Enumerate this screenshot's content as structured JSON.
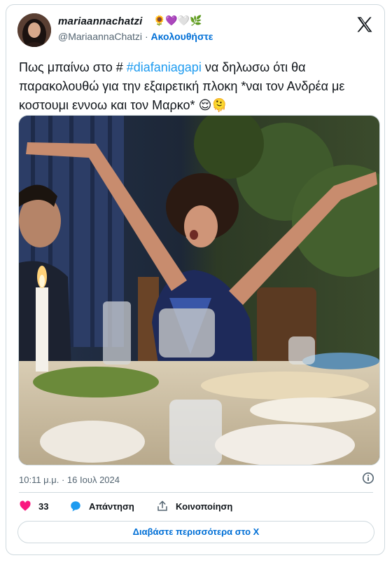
{
  "author": {
    "display_name": "mariaannachatzi",
    "name_emojis": "🌻💜🤍🌿",
    "handle": "@MariaannaChatzi",
    "separator": "·",
    "follow_label": "Ακολουθήστε"
  },
  "tweet": {
    "text_before": "Πως μπαίνω στο # ",
    "hashtag": "#diafaniagapi",
    "text_after": " να δηλωσω ότι θα παρακολουθώ για την εξαιρετική πλοκη *ναι τον Ανδρέα με κοστουμι εννοω και τον Μαρκο* ",
    "emojis": "😌🫠"
  },
  "meta": {
    "timestamp": "10:11 μ.μ. · 16 Ιουλ 2024"
  },
  "actions": {
    "like_count": "33",
    "reply_label": "Απάντηση",
    "share_label": "Κοινοποίηση"
  },
  "read_more": {
    "label": "Διαβάστε περισσότερα στο X"
  },
  "colors": {
    "link": "#1d9bf0",
    "follow": "#006fd6",
    "like": "#f91880",
    "reply": "#1d9bf0"
  }
}
